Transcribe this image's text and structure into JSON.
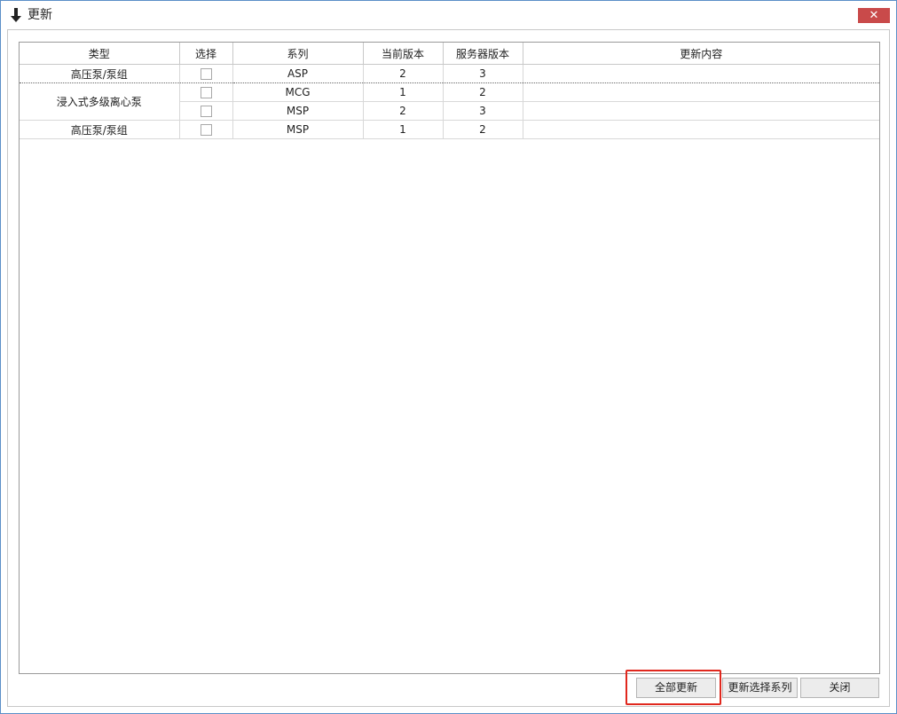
{
  "window": {
    "title": "更新",
    "close_label": "✕",
    "icon": "down-arrow-icon"
  },
  "table": {
    "headers": [
      "类型",
      "选择",
      "系列",
      "当前版本",
      "服务器版本",
      "更新内容"
    ],
    "rows": [
      {
        "type": "高压泵/泵组",
        "checked": false,
        "series": "ASP",
        "current": "2",
        "server": "3",
        "content": ""
      },
      {
        "type": "浸入式多级离心泵",
        "checked": false,
        "series": "MCG",
        "current": "1",
        "server": "2",
        "content": ""
      },
      {
        "type": "",
        "checked": false,
        "series": "MSP",
        "current": "2",
        "server": "3",
        "content": ""
      },
      {
        "type": "高压泵/泵组",
        "checked": false,
        "series": "MSP",
        "current": "1",
        "server": "2",
        "content": ""
      }
    ]
  },
  "buttons": {
    "update_all": "全部更新",
    "update_selected": "更新选择系列",
    "close": "关闭"
  },
  "colors": {
    "window_border": "#5b8fc8",
    "close_button": "#c94a4a",
    "highlight": "#e0281e"
  }
}
